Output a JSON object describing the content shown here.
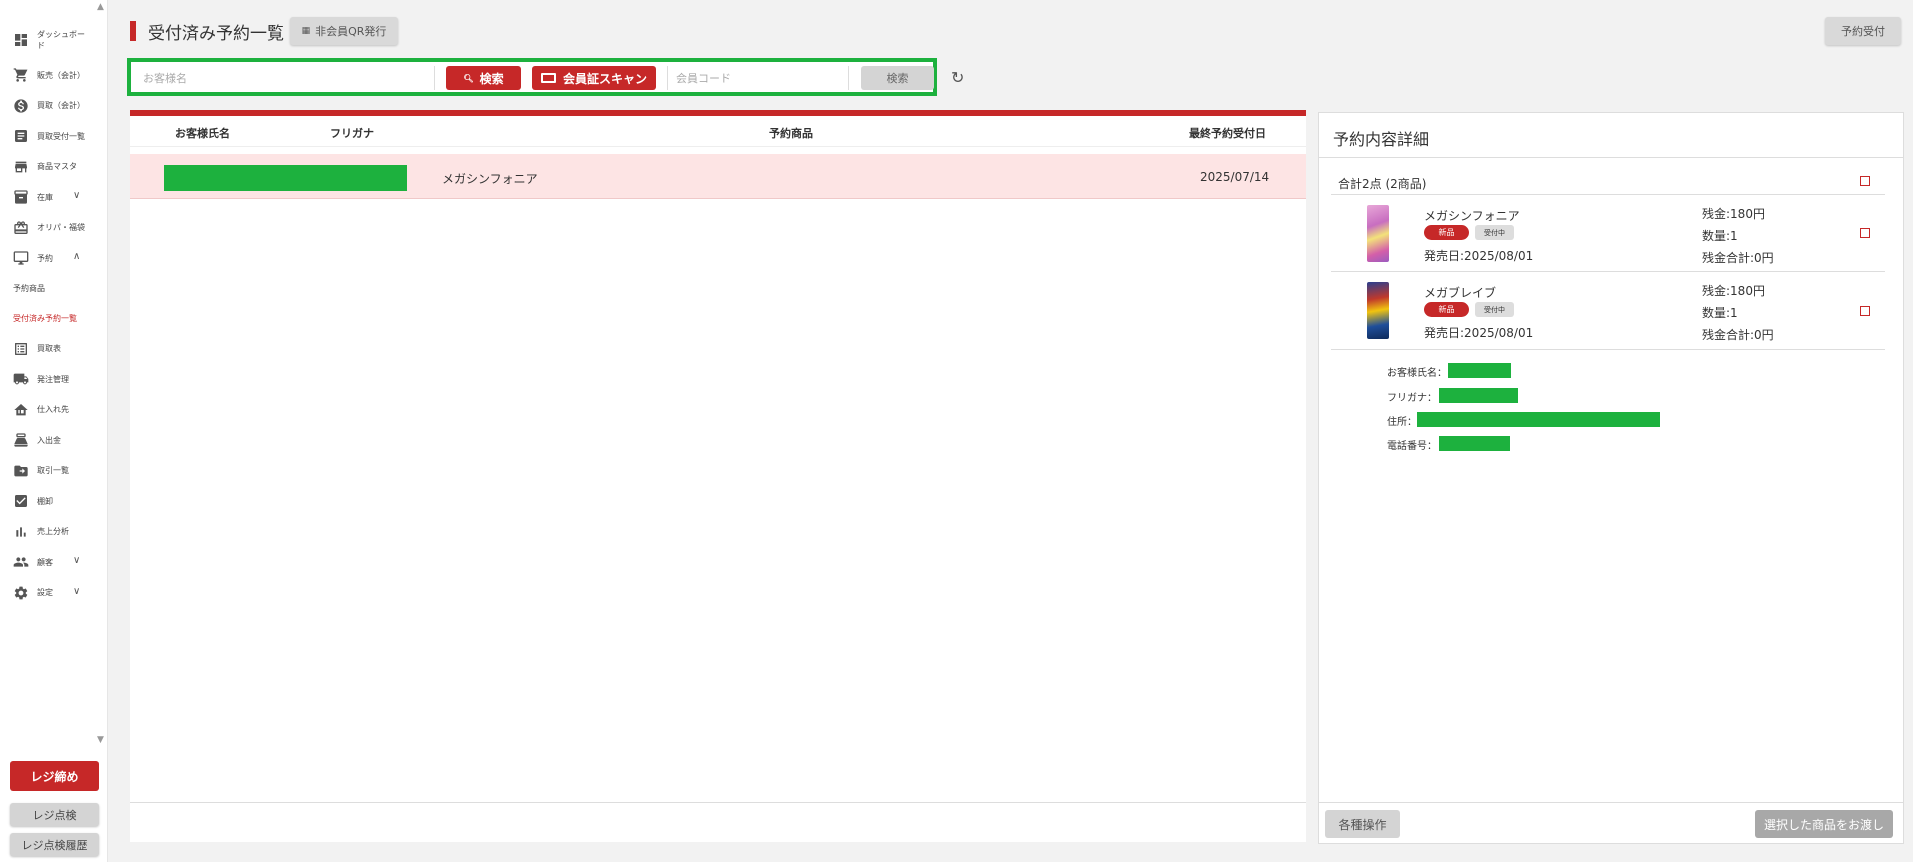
{
  "sidebar": {
    "items": [
      {
        "label": "ダッシュボード",
        "icon": "dashboard-icon"
      },
      {
        "label": "販売（会計）",
        "icon": "cart-icon"
      },
      {
        "label": "買取（会計）",
        "icon": "dollar-icon"
      },
      {
        "label": "買取受付一覧",
        "icon": "receipt-icon"
      },
      {
        "label": "商品マスタ",
        "icon": "store-icon"
      },
      {
        "label": "在庫",
        "icon": "archive-icon",
        "chevron": "∨"
      },
      {
        "label": "オリパ・福袋",
        "icon": "gift-icon"
      },
      {
        "label": "予約",
        "icon": "register-icon",
        "chevron": "∧"
      }
    ],
    "subitems": [
      {
        "label": "予約商品",
        "active": false
      },
      {
        "label": "受付済み予約一覧",
        "active": true
      }
    ],
    "items2": [
      {
        "label": "買取表",
        "icon": "list-icon"
      },
      {
        "label": "発注管理",
        "icon": "truck-icon"
      },
      {
        "label": "仕入れ先",
        "icon": "warehouse-icon"
      },
      {
        "label": "入出金",
        "icon": "cash-icon"
      },
      {
        "label": "取引一覧",
        "icon": "folder-icon"
      },
      {
        "label": "棚卸",
        "icon": "checkbox-icon"
      },
      {
        "label": "売上分析",
        "icon": "chart-icon"
      },
      {
        "label": "顧客",
        "icon": "people-icon",
        "chevron": "∨"
      },
      {
        "label": "設定",
        "icon": "gear-icon",
        "chevron": "∨"
      }
    ],
    "close_register": "レジ締め",
    "register_check": "レジ点検",
    "register_check_history": "レジ点検履歴"
  },
  "header": {
    "title": "受付済み予約一覧",
    "qr_button": "非会員QR発行",
    "reserve_button": "予約受付"
  },
  "search": {
    "name_placeholder": "お客様名",
    "search_button": "検索",
    "scan_button": "会員証スキャン",
    "code_placeholder": "会員コード",
    "code_search_button": "検索"
  },
  "table": {
    "headers": [
      "お客様氏名",
      "フリガナ",
      "予約商品",
      "最終予約受付日"
    ],
    "rows": [
      {
        "product": "メガシンフォニア",
        "date": "2025/07/14"
      }
    ]
  },
  "detail": {
    "title": "予約内容詳細",
    "total": "合計2点 (2商品)",
    "items": [
      {
        "name": "メガシンフォニア",
        "badge_new": "新品",
        "badge_status": "受付中",
        "release": "発売日:2025/08/01",
        "balance": "残金:180円",
        "qty": "数量:1",
        "balance_total": "残金合計:0円"
      },
      {
        "name": "メガブレイブ",
        "badge_new": "新品",
        "badge_status": "受付中",
        "release": "発売日:2025/08/01",
        "balance": "残金:180円",
        "qty": "数量:1",
        "balance_total": "残金合計:0円"
      }
    ],
    "customer": {
      "name_label": "お客様氏名：",
      "kana_label": "フリガナ：",
      "address_label": "住所：",
      "phone_label": "電話番号："
    },
    "ops_button": "各種操作",
    "handover_button": "選択した商品をお渡し"
  },
  "colors": {
    "accent_red": "#c62828",
    "redaction_green": "#1db13e",
    "row_highlight": "#fde4e4"
  }
}
